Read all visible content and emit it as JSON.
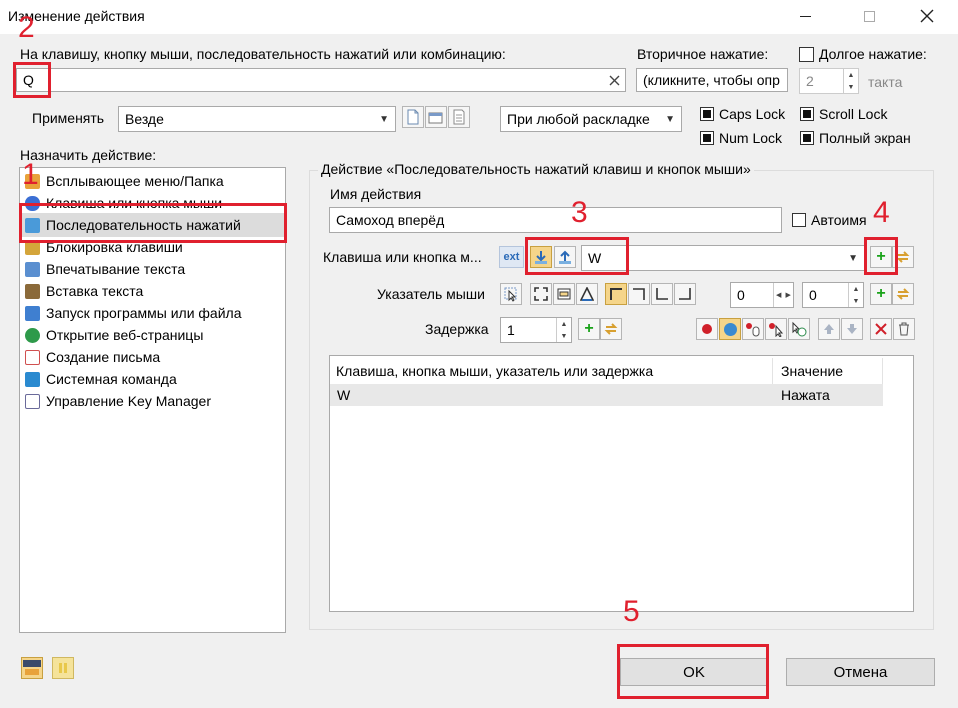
{
  "window": {
    "title": "Изменение действия",
    "minimize_icon": "minimize-icon",
    "maximize_icon": "maximize-icon",
    "close_icon": "close-icon"
  },
  "hotkey": {
    "label": "На клавишу, кнопку мыши, последовательность нажатий или комбинацию:",
    "value": "Q",
    "secondary_label": "Вторичное нажатие:",
    "secondary_value": "(кликните, чтобы опр",
    "long_press_label": "Долгое нажатие:",
    "long_press_checked": false,
    "tact_value": "2",
    "tact_label": "такта"
  },
  "apply": {
    "label": "Применять",
    "value": "Везде",
    "layout_value": "При любой раскладке"
  },
  "toggles": [
    {
      "label": "Caps Lock",
      "checked": true
    },
    {
      "label": "Scroll Lock",
      "checked": true
    },
    {
      "label": "Num Lock",
      "checked": true
    },
    {
      "label": "Полный экран",
      "checked": true
    }
  ],
  "assign": {
    "label": "Назначить действие:",
    "items": [
      {
        "label": "Всплывающее меню/Папка",
        "icon": "folder-menu-icon",
        "color": "#e8a23a"
      },
      {
        "label": "Клавиша или кнопка мыши",
        "icon": "mouse-icon",
        "color": "#3b6fd4"
      },
      {
        "label": "Последовательность нажатий",
        "icon": "sequence-icon",
        "color": "#4a9ad9"
      },
      {
        "label": "Блокировка клавиши",
        "icon": "lock-icon",
        "color": "#d4a53a"
      },
      {
        "label": "Впечатывание текста",
        "icon": "text-type-icon",
        "color": "#5a8fd0"
      },
      {
        "label": "Вставка текста",
        "icon": "paste-icon",
        "color": "#8b6a3a"
      },
      {
        "label": "Запуск программы или файла",
        "icon": "run-program-icon",
        "color": "#3f7fd0"
      },
      {
        "label": "Открытие веб-страницы",
        "icon": "globe-icon",
        "color": "#2e9a4a"
      },
      {
        "label": "Создание письма",
        "icon": "mail-icon",
        "color": "#d05050"
      },
      {
        "label": "Системная команда",
        "icon": "system-monitor-icon",
        "color": "#2a8ad0"
      },
      {
        "label": "Управление Key Manager",
        "icon": "key-manager-icon",
        "color": "#6a6a9a"
      }
    ]
  },
  "action": {
    "group_label": "Действие «Последовательность нажатий клавиш и кнопок мыши»",
    "name_label": "Имя действия",
    "name_value": "Самоход вперёд",
    "autoname_label": "Автоимя",
    "autoname_checked": false,
    "key_label": "Клавиша или кнопка м...",
    "ext_label": "ext",
    "key_value": "W",
    "pointer_label": "Указатель мыши",
    "pointer_x": "0",
    "pointer_y": "0",
    "delay_label": "Задержка",
    "delay_value": "1"
  },
  "table": {
    "headers": [
      "Клавиша, кнопка мыши, указатель или задержка",
      "Значение"
    ],
    "rows": [
      {
        "key": "W",
        "value": "Нажата"
      }
    ]
  },
  "buttons": {
    "ok": "OK",
    "cancel": "Отмена"
  },
  "annotations": [
    "1",
    "2",
    "3",
    "4",
    "5"
  ],
  "colors": {
    "annotation": "#e0202e",
    "add_green": "#1aa31a",
    "record_red": "#d0202a",
    "selection": "#dcdcdc"
  }
}
